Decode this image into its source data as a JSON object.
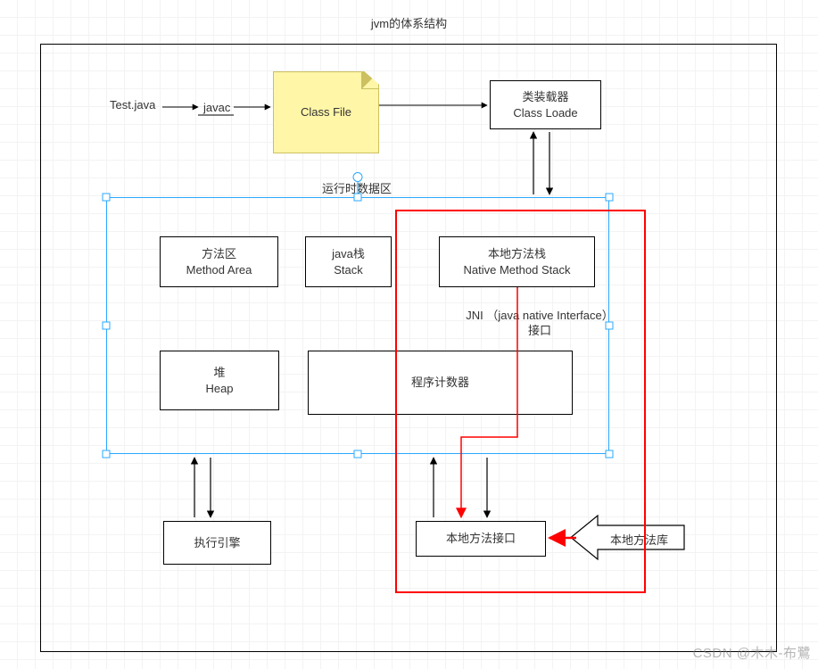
{
  "title": "jvm的体系结构",
  "runtime_title": "运行时数据区",
  "source_file": "Test.java",
  "compiler": "javac",
  "class_file": "Class File",
  "class_loader": {
    "line1": "类装载器",
    "line2": "Class Loade"
  },
  "method_area": {
    "line1": "方法区",
    "line2": "Method Area"
  },
  "java_stack": {
    "line1": "java栈",
    "line2": "Stack"
  },
  "native_stack": {
    "line1": "本地方法栈",
    "line2": "Native Method Stack"
  },
  "heap": {
    "line1": "堆",
    "line2": "Heap"
  },
  "pc_register": "程序计数器",
  "jni": {
    "line1": "JNI （java native Interface）",
    "line2": "接口"
  },
  "exec_engine": "执行引擎",
  "native_interface": "本地方法接口",
  "native_library": "本地方法库",
  "watermark": "CSDN @木木-布鷺"
}
